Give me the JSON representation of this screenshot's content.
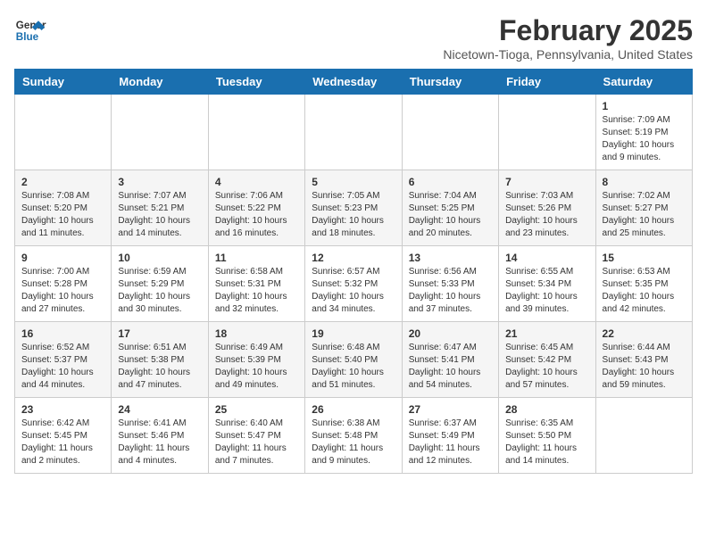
{
  "header": {
    "logo_line1": "General",
    "logo_line2": "Blue",
    "month": "February 2025",
    "location": "Nicetown-Tioga, Pennsylvania, United States"
  },
  "weekdays": [
    "Sunday",
    "Monday",
    "Tuesday",
    "Wednesday",
    "Thursday",
    "Friday",
    "Saturday"
  ],
  "weeks": [
    [
      {
        "day": "",
        "info": ""
      },
      {
        "day": "",
        "info": ""
      },
      {
        "day": "",
        "info": ""
      },
      {
        "day": "",
        "info": ""
      },
      {
        "day": "",
        "info": ""
      },
      {
        "day": "",
        "info": ""
      },
      {
        "day": "1",
        "info": "Sunrise: 7:09 AM\nSunset: 5:19 PM\nDaylight: 10 hours and 9 minutes."
      }
    ],
    [
      {
        "day": "2",
        "info": "Sunrise: 7:08 AM\nSunset: 5:20 PM\nDaylight: 10 hours and 11 minutes."
      },
      {
        "day": "3",
        "info": "Sunrise: 7:07 AM\nSunset: 5:21 PM\nDaylight: 10 hours and 14 minutes."
      },
      {
        "day": "4",
        "info": "Sunrise: 7:06 AM\nSunset: 5:22 PM\nDaylight: 10 hours and 16 minutes."
      },
      {
        "day": "5",
        "info": "Sunrise: 7:05 AM\nSunset: 5:23 PM\nDaylight: 10 hours and 18 minutes."
      },
      {
        "day": "6",
        "info": "Sunrise: 7:04 AM\nSunset: 5:25 PM\nDaylight: 10 hours and 20 minutes."
      },
      {
        "day": "7",
        "info": "Sunrise: 7:03 AM\nSunset: 5:26 PM\nDaylight: 10 hours and 23 minutes."
      },
      {
        "day": "8",
        "info": "Sunrise: 7:02 AM\nSunset: 5:27 PM\nDaylight: 10 hours and 25 minutes."
      }
    ],
    [
      {
        "day": "9",
        "info": "Sunrise: 7:00 AM\nSunset: 5:28 PM\nDaylight: 10 hours and 27 minutes."
      },
      {
        "day": "10",
        "info": "Sunrise: 6:59 AM\nSunset: 5:29 PM\nDaylight: 10 hours and 30 minutes."
      },
      {
        "day": "11",
        "info": "Sunrise: 6:58 AM\nSunset: 5:31 PM\nDaylight: 10 hours and 32 minutes."
      },
      {
        "day": "12",
        "info": "Sunrise: 6:57 AM\nSunset: 5:32 PM\nDaylight: 10 hours and 34 minutes."
      },
      {
        "day": "13",
        "info": "Sunrise: 6:56 AM\nSunset: 5:33 PM\nDaylight: 10 hours and 37 minutes."
      },
      {
        "day": "14",
        "info": "Sunrise: 6:55 AM\nSunset: 5:34 PM\nDaylight: 10 hours and 39 minutes."
      },
      {
        "day": "15",
        "info": "Sunrise: 6:53 AM\nSunset: 5:35 PM\nDaylight: 10 hours and 42 minutes."
      }
    ],
    [
      {
        "day": "16",
        "info": "Sunrise: 6:52 AM\nSunset: 5:37 PM\nDaylight: 10 hours and 44 minutes."
      },
      {
        "day": "17",
        "info": "Sunrise: 6:51 AM\nSunset: 5:38 PM\nDaylight: 10 hours and 47 minutes."
      },
      {
        "day": "18",
        "info": "Sunrise: 6:49 AM\nSunset: 5:39 PM\nDaylight: 10 hours and 49 minutes."
      },
      {
        "day": "19",
        "info": "Sunrise: 6:48 AM\nSunset: 5:40 PM\nDaylight: 10 hours and 51 minutes."
      },
      {
        "day": "20",
        "info": "Sunrise: 6:47 AM\nSunset: 5:41 PM\nDaylight: 10 hours and 54 minutes."
      },
      {
        "day": "21",
        "info": "Sunrise: 6:45 AM\nSunset: 5:42 PM\nDaylight: 10 hours and 57 minutes."
      },
      {
        "day": "22",
        "info": "Sunrise: 6:44 AM\nSunset: 5:43 PM\nDaylight: 10 hours and 59 minutes."
      }
    ],
    [
      {
        "day": "23",
        "info": "Sunrise: 6:42 AM\nSunset: 5:45 PM\nDaylight: 11 hours and 2 minutes."
      },
      {
        "day": "24",
        "info": "Sunrise: 6:41 AM\nSunset: 5:46 PM\nDaylight: 11 hours and 4 minutes."
      },
      {
        "day": "25",
        "info": "Sunrise: 6:40 AM\nSunset: 5:47 PM\nDaylight: 11 hours and 7 minutes."
      },
      {
        "day": "26",
        "info": "Sunrise: 6:38 AM\nSunset: 5:48 PM\nDaylight: 11 hours and 9 minutes."
      },
      {
        "day": "27",
        "info": "Sunrise: 6:37 AM\nSunset: 5:49 PM\nDaylight: 11 hours and 12 minutes."
      },
      {
        "day": "28",
        "info": "Sunrise: 6:35 AM\nSunset: 5:50 PM\nDaylight: 11 hours and 14 minutes."
      },
      {
        "day": "",
        "info": ""
      }
    ]
  ]
}
